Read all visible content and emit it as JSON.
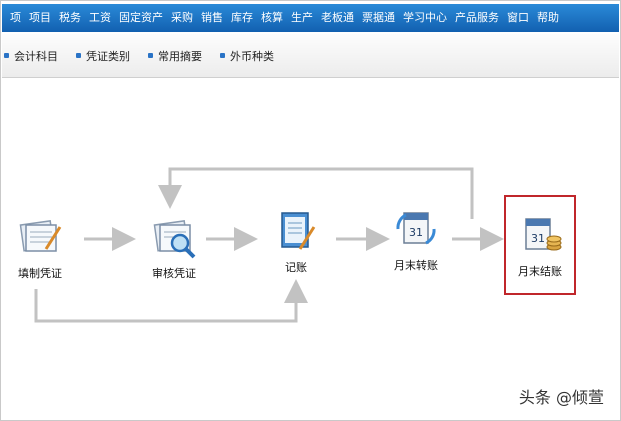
{
  "menu": {
    "items": [
      "项",
      "项目",
      "税务",
      "工资",
      "固定资产",
      "采购",
      "销售",
      "库存",
      "核算",
      "生产",
      "老板通",
      "票据通",
      "学习中心",
      "产品服务",
      "窗口",
      "帮助"
    ]
  },
  "toolbar": {
    "items": [
      "会计科目",
      "凭证类别",
      "常用摘要",
      "外币种类"
    ]
  },
  "workflow": {
    "steps": [
      {
        "label": "填制凭证",
        "icon": "voucher-fill-icon"
      },
      {
        "label": "审核凭证",
        "icon": "voucher-audit-icon"
      },
      {
        "label": "记账",
        "icon": "bookkeeping-icon"
      },
      {
        "label": "月末转账",
        "icon": "month-end-transfer-icon"
      },
      {
        "label": "月末结账",
        "icon": "month-end-closing-icon"
      }
    ],
    "highlighted_step": "月末结账",
    "highlight_color": "#c0262b"
  },
  "watermark": "头条 @倾萱",
  "colors": {
    "menubar": "#1a72c4",
    "arrow": "#c2c2c2"
  }
}
